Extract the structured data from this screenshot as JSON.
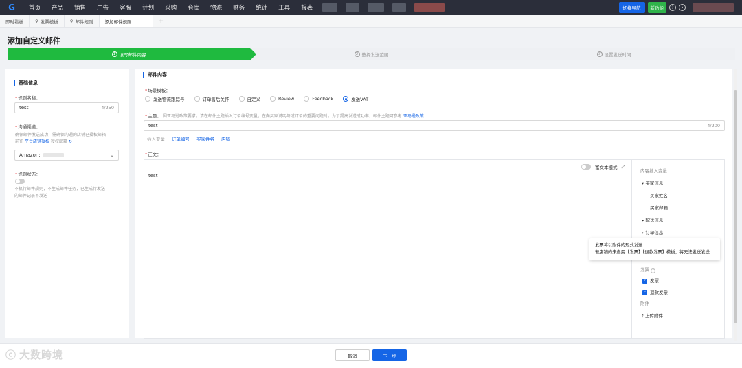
{
  "topnav": {
    "logo": "G",
    "items": [
      "首页",
      "产品",
      "销售",
      "广告",
      "客服",
      "计划",
      "采购",
      "仓库",
      "物流",
      "财务",
      "统计",
      "工具",
      "报表"
    ],
    "switch_nav": "切换导航",
    "new_feature": "新功能"
  },
  "tabs": [
    {
      "label": "即时看板"
    },
    {
      "label": "发票模板"
    },
    {
      "label": "邮件规则"
    },
    {
      "label": "添加邮件规则"
    },
    {
      "label": "+"
    }
  ],
  "page": {
    "title": "添加自定义邮件"
  },
  "steps": [
    {
      "num": "1",
      "label": "填写邮件内容",
      "active": true
    },
    {
      "num": "2",
      "label": "选择发送范围",
      "active": false
    },
    {
      "num": "3",
      "label": "设置发送时间",
      "active": false
    }
  ],
  "basic": {
    "section_title": "基础信息",
    "rule_name_label": "规则名称：",
    "rule_name_value": "test",
    "rule_name_count": "4/250",
    "channel_label": "沟通渠道：",
    "channel_hint1": "确保邮件发送成功，需确保沟通的店铺已授权邮箱",
    "channel_hint2_prefix": "前往",
    "channel_hint2_link": "平台店铺授权",
    "channel_hint2_suffix": "授权邮箱",
    "channel_value": "Amazon:",
    "status_label": "规则状态：",
    "status_hint1": "不执行邮件规则，不生成邮件任务，已生成待发送",
    "status_hint2": "的邮件记录不发送"
  },
  "mail": {
    "section_title": "邮件内容",
    "template_label": "场景模板：",
    "templates": [
      {
        "label": "发送物流跟踪号",
        "selected": false
      },
      {
        "label": "订单售后关怀",
        "selected": false
      },
      {
        "label": "自定义",
        "selected": false
      },
      {
        "label": "Review",
        "selected": false
      },
      {
        "label": "Feedback",
        "selected": false
      },
      {
        "label": "发送VAT",
        "selected": true
      }
    ],
    "subject_label": "主题：",
    "subject_hint": "因亚马逊政策要求，请在邮件主题插入订单编号变量；在向买家说明与或订单的重要问题时，为了提高发送成功率，邮件主题可参考",
    "subject_hint_link": "亚马逊政策",
    "subject_value": "test",
    "subject_count": "4/200",
    "insert_label": "插入变量",
    "insert_vars": [
      "订单编号",
      "买家姓名",
      "店铺"
    ],
    "body_label": "正文：",
    "body_value": "test",
    "rich_text": "富文本模式"
  },
  "vars_panel": {
    "title": "内容插入变量",
    "buyer_group": "买家信息",
    "buyer_name": "买家姓名",
    "buyer_email": "买家邮箱",
    "shipping_group": "配送信息",
    "order_group": "订单信息",
    "invoice_label": "发票",
    "invoice_opt1": "发票",
    "invoice_opt2": "退款发票",
    "attachment_label": "附件",
    "upload": "上传附件"
  },
  "tooltip": {
    "line1": "发票将以附件的形式发送",
    "line2": "若店铺的未启用【发票】【退款发票】模板，将无法发送发送"
  },
  "footer": {
    "cancel": "取消",
    "next": "下一步",
    "brand": "大数跨境"
  }
}
